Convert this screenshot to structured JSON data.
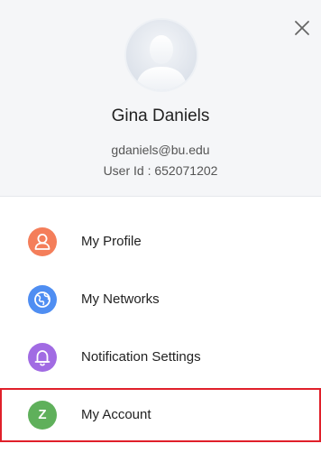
{
  "profile": {
    "name": "Gina Daniels",
    "email": "gdaniels@bu.edu",
    "user_id_line": "User Id : 652071202"
  },
  "menu": {
    "items": [
      {
        "label": "My Profile",
        "icon": "person-icon",
        "color": "#f47e5a"
      },
      {
        "label": "My Networks",
        "icon": "globe-icon",
        "color": "#4f8ef2"
      },
      {
        "label": "Notification Settings",
        "icon": "bell-icon",
        "color": "#a16be3"
      },
      {
        "label": "My Account",
        "icon": "letter-z-icon",
        "letter": "Z",
        "color": "#5fb05b"
      }
    ]
  },
  "colors": {
    "highlight_border": "#e0202a"
  }
}
